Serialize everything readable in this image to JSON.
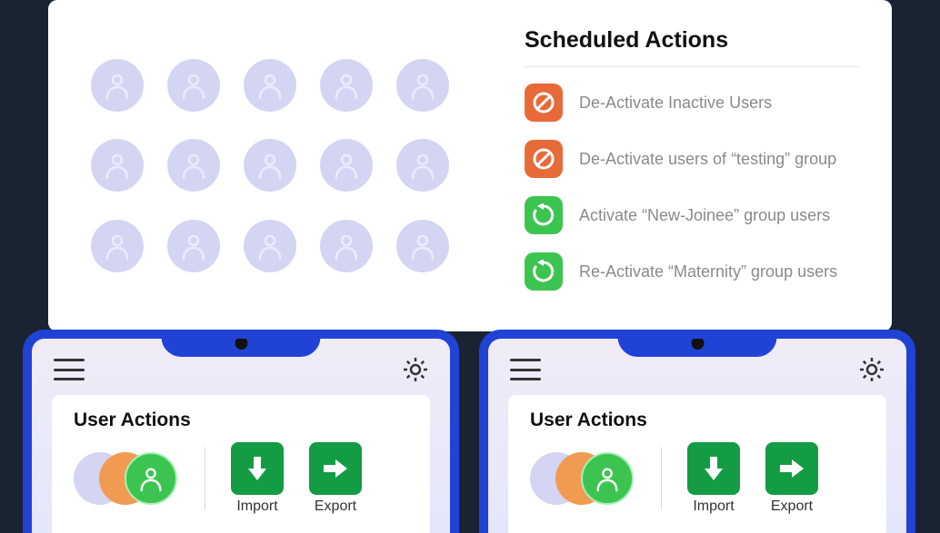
{
  "scheduled": {
    "title": "Scheduled Actions",
    "items": [
      {
        "type": "deactivate",
        "label": "De-Activate Inactive Users"
      },
      {
        "type": "deactivate",
        "label": "De-Activate users of “testing” group"
      },
      {
        "type": "activate",
        "label": "Activate “New-Joinee” group users"
      },
      {
        "type": "activate",
        "label": "Re-Activate “Maternity” group users"
      }
    ]
  },
  "tabletLeft": {
    "panelTitle": "User Actions",
    "importLabel": "Import",
    "exportLabel": "Export"
  },
  "tabletRight": {
    "panelTitle": "User Actions",
    "importLabel": "Import",
    "exportLabel": "Export"
  },
  "colors": {
    "frame": "#2043d6",
    "deactivate": "#e86a38",
    "activate": "#3bc550",
    "buttonGreen": "#139c44",
    "avatarLavender": "#d4d5f2"
  }
}
